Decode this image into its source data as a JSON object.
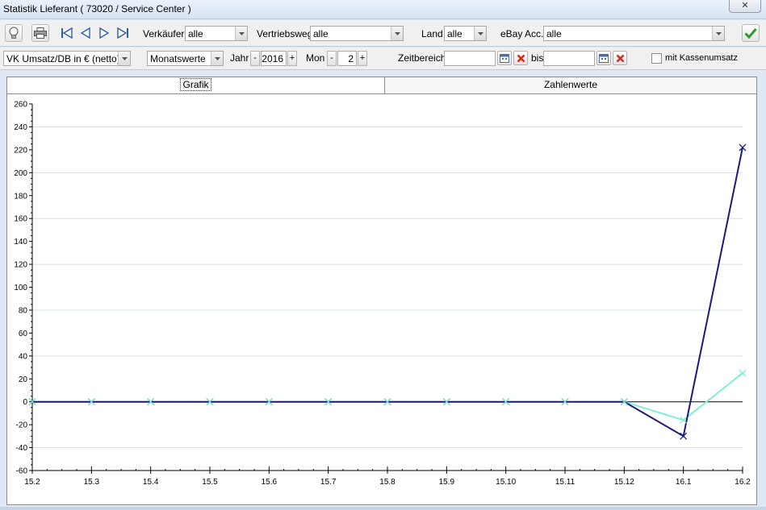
{
  "window": {
    "title": "Statistik Lieferant ( 73020 / Service Center )",
    "close_glyph": "✕"
  },
  "toolbar": {
    "verkaeufer_label": "Verkäufer",
    "verkaeufer_value": "alle",
    "vertriebsweg_label": "Vertriebsweg",
    "vertriebsweg_value": "alle",
    "land_label": "Land",
    "land_value": "alle",
    "ebay_label": "eBay Acc.",
    "ebay_value": "alle",
    "icons": [
      "lightbulb-icon",
      "printer-icon",
      "first-icon",
      "previous-icon",
      "next-icon",
      "last-icon",
      "confirm-check-icon"
    ]
  },
  "filters": {
    "measure_value": "VK Umsatz/DB in € (netto)",
    "period_value": "Monatswerte",
    "jahr_label": "Jahr",
    "jahr_value": "2016",
    "mon_label": "Mon",
    "mon_value": "2",
    "minus": "-",
    "plus": "+",
    "zeitbereich_label": "Zeitbereich",
    "zeitbereich_from": "",
    "bis_label": "bis",
    "zeitbereich_to": "",
    "kassenumsatz_label": "mit Kassenumsatz",
    "kassenumsatz_checked": false
  },
  "tabs": [
    {
      "label": "Grafik",
      "active": true
    },
    {
      "label": "Zahlenwerte",
      "active": false
    }
  ],
  "colors": {
    "series_umsatz": "#1a1a7a",
    "series_db": "#7fefd4",
    "gridline": "#d6e0ec",
    "zero_line": "#000000"
  },
  "chart_data": {
    "type": "line",
    "x": [
      "15.2",
      "15.3",
      "15.4",
      "15.5",
      "15.6",
      "15.7",
      "15.8",
      "15.9",
      "15.10",
      "15.11",
      "15.12",
      "16.1",
      "16.2"
    ],
    "series": [
      {
        "values": [
          0,
          0,
          0,
          0,
          0,
          0,
          0,
          0,
          0,
          0,
          0,
          -30,
          222
        ],
        "color": "#1a1a7a"
      },
      {
        "values": [
          0,
          0,
          0,
          0,
          0,
          0,
          0,
          0,
          0,
          0,
          0,
          -16,
          25
        ],
        "color": "#7fefd4"
      }
    ],
    "ylim": [
      -60,
      260
    ],
    "yticks": [
      -60,
      -40,
      -20,
      0,
      20,
      40,
      60,
      80,
      100,
      120,
      140,
      160,
      180,
      200,
      220,
      240,
      260
    ],
    "grid": true,
    "legend": "none"
  }
}
